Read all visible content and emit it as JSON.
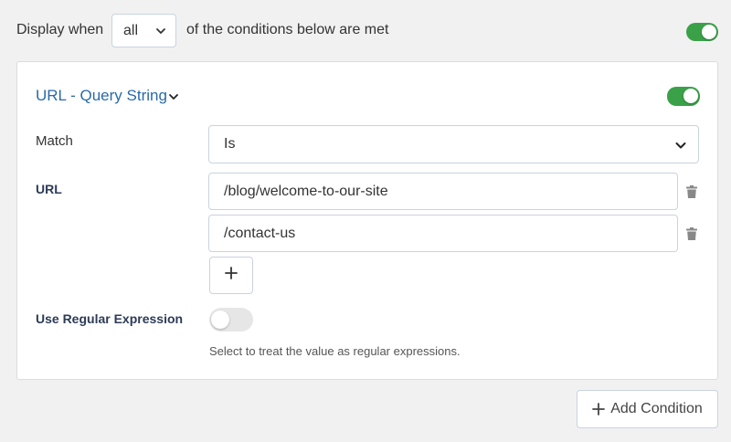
{
  "header": {
    "display_when_label": "Display when",
    "match_select_value": "all",
    "tail_label": "of the conditions below are met",
    "enabled": true
  },
  "condition": {
    "title": "URL - Query String",
    "enabled": true,
    "match_label": "Match",
    "match_value": "Is",
    "url_label": "URL",
    "urls": [
      "/blog/welcome-to-our-site",
      "/contact-us"
    ],
    "regex_label": "Use Regular Expression",
    "regex_enabled": false,
    "regex_help": "Select to treat the value as regular expressions."
  },
  "actions": {
    "add_condition_label": "Add Condition"
  },
  "colors": {
    "toggle_on": "#3aa148",
    "toggle_off": "#e6e6e6",
    "title_blue": "#2a6aaa",
    "label_navy": "#2d3b57"
  },
  "icons": {
    "chevron": "chevron-down-icon",
    "trash": "trash-icon",
    "plus": "plus-icon"
  }
}
